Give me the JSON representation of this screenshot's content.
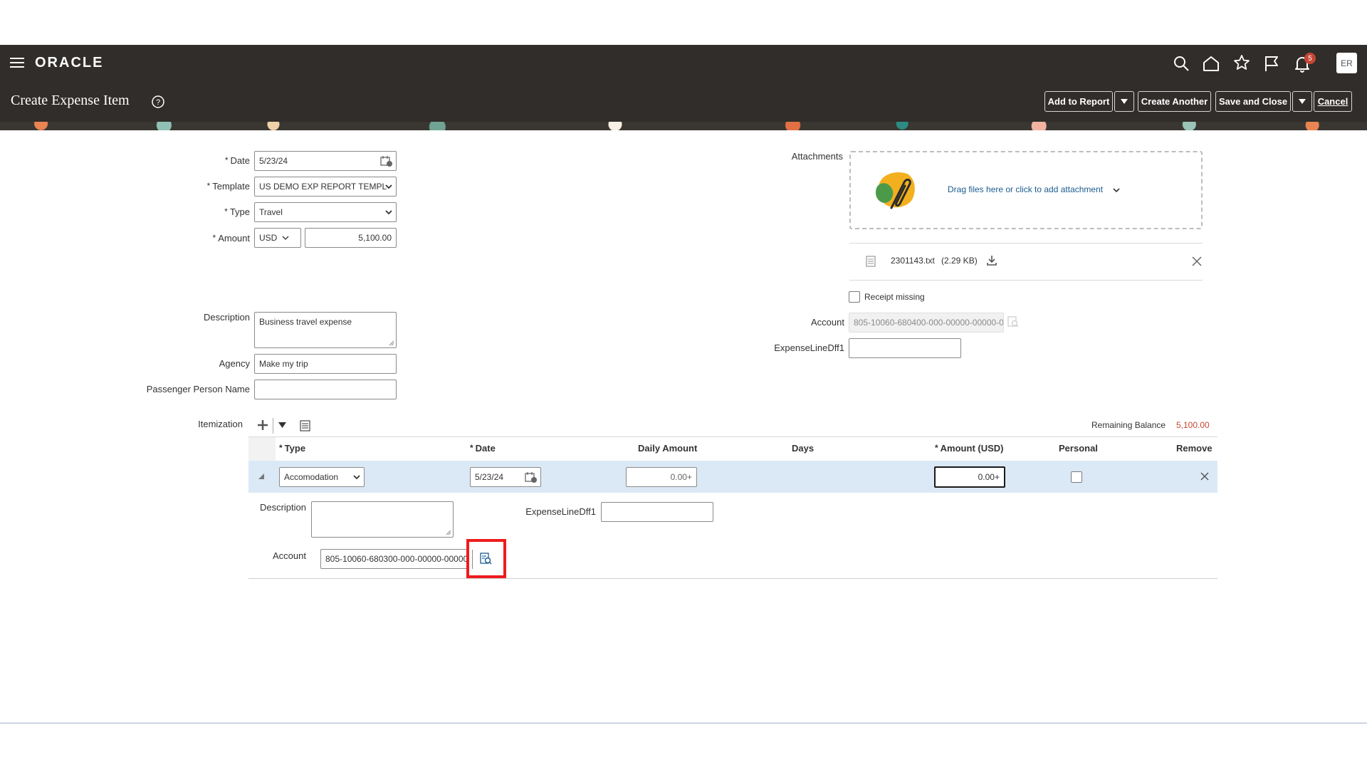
{
  "brand": {
    "name": "ORACLE"
  },
  "header": {
    "title": "Create Expense Item",
    "notification_count": "5",
    "user_initials": "ER",
    "buttons": {
      "add_to_report": "Add to Report",
      "create_another": "Create Another",
      "save_and_close": "Save and Close",
      "cancel": "Cancel"
    }
  },
  "form": {
    "date": {
      "label": "Date",
      "value": "5/23/24"
    },
    "template": {
      "label": "Template",
      "value": "US DEMO EXP REPORT TEMPL"
    },
    "type": {
      "label": "Type",
      "value": "Travel"
    },
    "amount": {
      "label": "Amount",
      "currency": "USD",
      "value": "5,100.00"
    },
    "description": {
      "label": "Description",
      "value": "Business travel expense"
    },
    "agency": {
      "label": "Agency",
      "value": "Make my trip"
    },
    "passenger": {
      "label": "Passenger Person Name",
      "value": ""
    }
  },
  "attachments": {
    "label": "Attachments",
    "drop_text": "Drag files here or click to add attachment",
    "file": {
      "name": "2301143.txt",
      "size": "(2.29 KB)"
    }
  },
  "right": {
    "receipt_missing": "Receipt missing",
    "account": {
      "label": "Account",
      "value": "805-10060-680400-000-00000-00000-0"
    },
    "dff": {
      "label": "ExpenseLineDff1",
      "value": ""
    }
  },
  "itemization": {
    "label": "Itemization",
    "remaining_balance_label": "Remaining Balance",
    "remaining_balance_value": "5,100.00",
    "columns": {
      "type": "Type",
      "date": "Date",
      "daily_amount": "Daily Amount",
      "days": "Days",
      "amount_usd": "Amount (USD)",
      "personal": "Personal",
      "remove": "Remove"
    },
    "row": {
      "type": "Accomodation",
      "date": "5/23/24",
      "daily_amount": "0.00+",
      "amount": "0.00+"
    },
    "detail": {
      "description_label": "Description",
      "description_value": "",
      "dff_label": "ExpenseLineDff1",
      "dff_value": "",
      "account_label": "Account",
      "account_value": "805-10060-680300-000-00000-00000"
    }
  },
  "colors": {
    "header_bg": "#312d2a",
    "accent_red": "#c74634",
    "link_blue": "#1b5c8f",
    "row_highlight": "#dbe9f6",
    "callout_red": "#ee1c1c"
  }
}
